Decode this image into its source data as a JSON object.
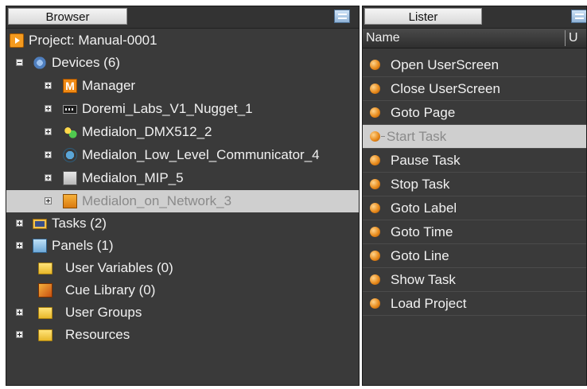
{
  "browser": {
    "tab_label": "Browser",
    "project_label": "Project: Manual-0001",
    "devices_label": "Devices (6)",
    "devices": [
      "Manager",
      "Doremi_Labs_V1_Nugget_1",
      "Medialon_DMX512_2",
      "Medialon_Low_Level_Communicator_4",
      "Medialon_MIP_5",
      "Medialon_on_Network_3"
    ],
    "tasks_label": "Tasks (2)",
    "panels_label": "Panels (1)",
    "user_variables_label": "User Variables (0)",
    "cue_library_label": "Cue Library (0)",
    "user_groups_label": "User Groups",
    "resources_label": "Resources",
    "selected_device": "Medialon_on_Network_3"
  },
  "lister": {
    "tab_label": "Lister",
    "col_name": "Name",
    "col_u": "U",
    "items": [
      "Open UserScreen",
      "Close UserScreen",
      "Goto Page",
      "Start Task",
      "Pause Task",
      "Stop Task",
      "Goto Label",
      "Goto Time",
      "Goto Line",
      "Show Task",
      "Load Project"
    ],
    "selected_item": "Start Task"
  },
  "icons": {
    "project": "project-icon",
    "devices": "devices-gear-icon",
    "manager": "manager-m-icon",
    "nugget": "nugget-device-icon",
    "dmx": "dmx-device-icon",
    "low_level": "communicator-device-icon",
    "mip": "mip-device-icon",
    "network": "network-device-icon",
    "tasks": "tasks-icon",
    "panels": "panels-icon",
    "folder": "folder-icon",
    "cue": "cue-library-icon",
    "command": "command-dot-icon"
  },
  "colors": {
    "pane_bg": "#3a3a3a",
    "selection_bg": "#cfcfcf",
    "text": "#f1f1f1",
    "accent_orange": "#e88b1d"
  }
}
